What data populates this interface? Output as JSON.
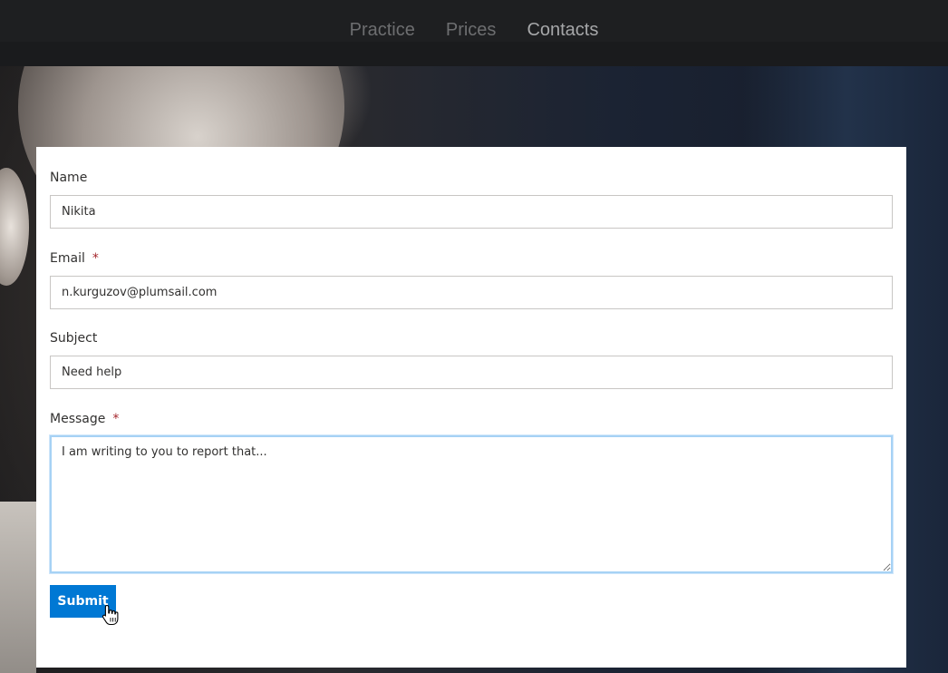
{
  "nav": {
    "links": [
      {
        "label": "Practice"
      },
      {
        "label": "Prices"
      },
      {
        "label": "Contacts"
      }
    ]
  },
  "form": {
    "name": {
      "label": "Name",
      "value": "Nikita"
    },
    "email": {
      "label": "Email",
      "required_mark": "*",
      "value": "n.kurguzov@plumsail.com"
    },
    "subject": {
      "label": "Subject",
      "value": "Need help"
    },
    "message": {
      "label": "Message",
      "required_mark": "*",
      "value": "I am writing to you to report that..."
    },
    "submit_label": "Submit"
  },
  "colors": {
    "accent": "#0078d4",
    "required": "#a4262c",
    "focus_border": "#a6d2f5"
  },
  "icons": {
    "cursor": "hand-pointer-icon"
  }
}
